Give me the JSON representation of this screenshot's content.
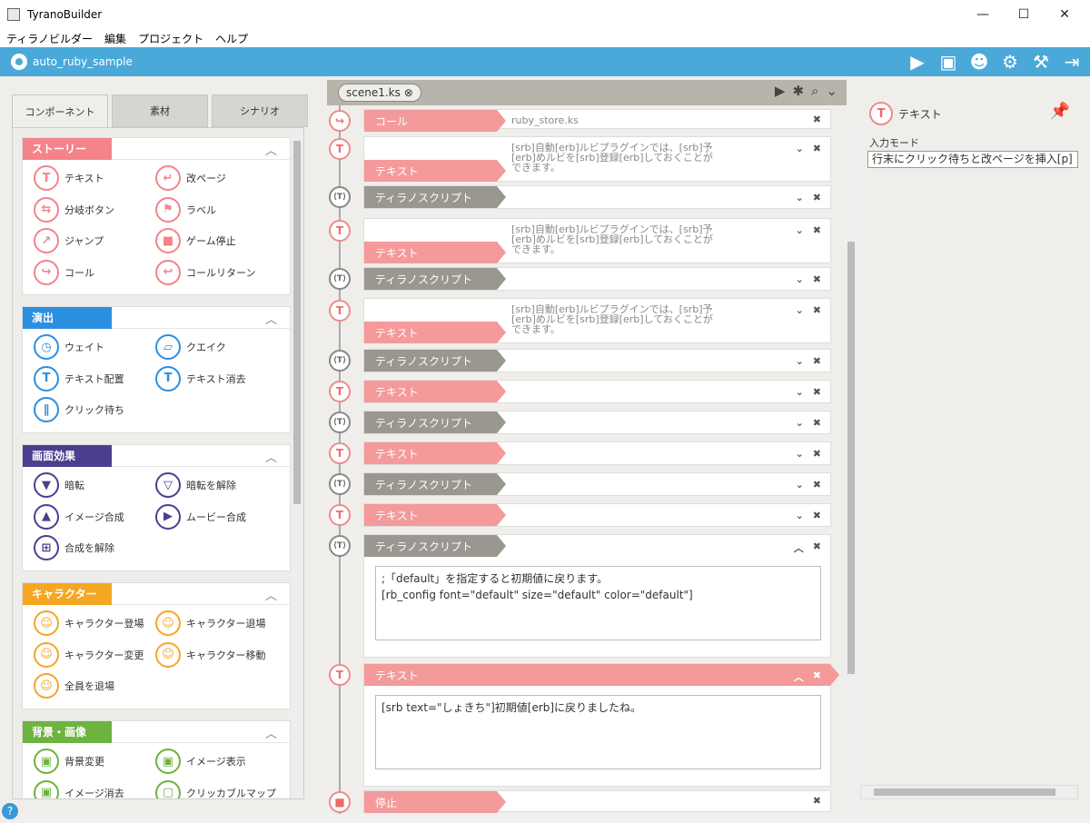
{
  "window": {
    "title": "TyranoBuilder",
    "minimize": "—",
    "maximize": "☐",
    "close": "✕"
  },
  "menu": [
    "ティラノビルダー",
    "編集",
    "プロジェクト",
    "ヘルプ"
  ],
  "project": {
    "name": "auto_ruby_sample"
  },
  "left": {
    "tabs": [
      "コンポーネント",
      "素材",
      "シナリオ"
    ],
    "sections": [
      {
        "title": "ストーリー",
        "color": "#f4848a",
        "items": [
          {
            "label": "テキスト",
            "icon": "T"
          },
          {
            "label": "改ページ",
            "icon": "↵"
          },
          {
            "label": "分岐ボタン",
            "icon": "⇆"
          },
          {
            "label": "ラベル",
            "icon": "⚑"
          },
          {
            "label": "ジャンプ",
            "icon": "↗"
          },
          {
            "label": "ゲーム停止",
            "icon": "■"
          },
          {
            "label": "コール",
            "icon": "↪"
          },
          {
            "label": "コールリターン",
            "icon": "↩"
          }
        ]
      },
      {
        "title": "演出",
        "color": "#2b8fe0",
        "items": [
          {
            "label": "ウェイト",
            "icon": "◷"
          },
          {
            "label": "クエイク",
            "icon": "▱"
          },
          {
            "label": "テキスト配置",
            "icon": "T"
          },
          {
            "label": "テキスト消去",
            "icon": "T"
          },
          {
            "label": "クリック待ち",
            "icon": "∥"
          }
        ]
      },
      {
        "title": "画面効果",
        "color": "#4a3f8f",
        "items": [
          {
            "label": "暗転",
            "icon": "▼"
          },
          {
            "label": "暗転を解除",
            "icon": "▽"
          },
          {
            "label": "イメージ合成",
            "icon": "▲"
          },
          {
            "label": "ムービー合成",
            "icon": "▶"
          },
          {
            "label": "合成を解除",
            "icon": "⊞"
          }
        ]
      },
      {
        "title": "キャラクター",
        "color": "#f5a623",
        "items": [
          {
            "label": "キャラクター登場",
            "icon": "☺"
          },
          {
            "label": "キャラクター退場",
            "icon": "☺"
          },
          {
            "label": "キャラクター変更",
            "icon": "☺"
          },
          {
            "label": "キャラクター移動",
            "icon": "☺"
          },
          {
            "label": "全員を退場",
            "icon": "☺"
          }
        ]
      },
      {
        "title": "背景・画像",
        "color": "#6cb33f",
        "items": [
          {
            "label": "背景変更",
            "icon": "▣"
          },
          {
            "label": "イメージ表示",
            "icon": "▣"
          },
          {
            "label": "イメージ消去",
            "icon": "▣"
          },
          {
            "label": "クリッカブルマップ",
            "icon": "▢"
          }
        ]
      }
    ]
  },
  "scene": {
    "tab": "scene1.ks"
  },
  "rows": [
    {
      "type": "コール",
      "kind": "call",
      "preview": "ruby_store.ks"
    },
    {
      "type": "テキスト",
      "kind": "text",
      "preview": "[srb]自動[erb]ルビプラグインでは、[srb]予[erb]めルビを[srb]登録[erb]しておくことができます。"
    },
    {
      "type": "ティラノスクリプト",
      "kind": "script",
      "preview": ""
    },
    {
      "type": "テキスト",
      "kind": "text",
      "preview": "[srb]自動[erb]ルビプラグインでは、[srb]予[erb]めルビを[srb]登録[erb]しておくことができます。"
    },
    {
      "type": "ティラノスクリプト",
      "kind": "script",
      "preview": ""
    },
    {
      "type": "テキスト",
      "kind": "text",
      "preview": "[srb]自動[erb]ルビプラグインでは、[srb]予[erb]めルビを[srb]登録[erb]しておくことができます。"
    },
    {
      "type": "ティラノスクリプト",
      "kind": "script",
      "preview": ""
    },
    {
      "type": "テキスト",
      "kind": "text",
      "preview": ""
    },
    {
      "type": "ティラノスクリプト",
      "kind": "script",
      "preview": ""
    },
    {
      "type": "テキスト",
      "kind": "text",
      "preview": ""
    },
    {
      "type": "ティラノスクリプト",
      "kind": "script",
      "preview": ""
    },
    {
      "type": "テキスト",
      "kind": "text",
      "preview": ""
    },
    {
      "type": "ティラノスクリプト",
      "kind": "script",
      "open": true,
      "body": [
        ";「default」を指定すると初期値に戻ります。",
        "[rb_config font=\"default\" size=\"default\" color=\"default\"]"
      ]
    },
    {
      "type": "テキスト",
      "kind": "text",
      "open": true,
      "body": [
        "[srb text=\"しょきち\"]初期値[erb]に戻りましたね。"
      ]
    },
    {
      "type": "停止",
      "kind": "stop",
      "preview": ""
    }
  ],
  "right": {
    "title": "テキスト",
    "field_label": "入力モード",
    "field_value": "行末にクリック待ちと改ページを挿入[p]"
  },
  "help": "?"
}
